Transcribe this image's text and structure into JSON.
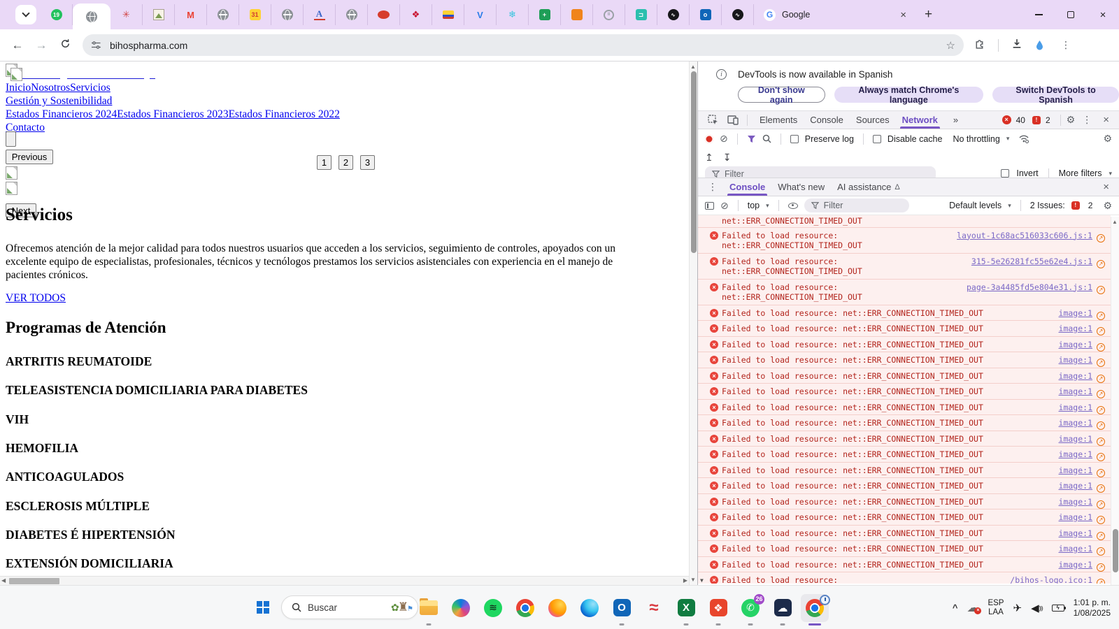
{
  "icons": {
    "back": "←",
    "forward": "→",
    "star": "☆",
    "more": "⋮",
    "overflow": "»",
    "caret": "▾",
    "clear": "⊘",
    "gear": "⚙",
    "close": "×",
    "plus": "+",
    "up_arrow": "↥",
    "down_arrow": "↧",
    "scroll_up": "▲",
    "scroll_down": "▼",
    "scroll_left": "◀",
    "scroll_right": "▶",
    "insight": "↗",
    "flask": "Δ",
    "info": "i",
    "error_x": "×",
    "issues_mark": "!",
    "flower": "✿",
    "castle": "♜",
    "bunting": "⚑",
    "airplane": "✈",
    "speaker": "◀",
    "bolt": "ϟ",
    "cloud": "☁",
    "hidden_chevron": "^"
  },
  "browser": {
    "tab_strip_color": "#ead9f7",
    "pinned_tabs": [
      {
        "name": "whatsapp-web-tab",
        "type": "circle",
        "bg": "#22c15e",
        "fg": "#ffffff",
        "glyph": "19"
      },
      {
        "name": "bihospharma-active-tab",
        "type": "globe",
        "active": true
      },
      {
        "name": "sparkle-tab",
        "type": "text",
        "glyph": "✳",
        "fg": "#d04545"
      },
      {
        "name": "photo-tab",
        "type": "photo"
      },
      {
        "name": "gmail-tab",
        "type": "text",
        "glyph": "M",
        "fg": "#ea4335"
      },
      {
        "name": "globe-tab-1",
        "type": "globe"
      },
      {
        "name": "calendar-tab",
        "type": "box",
        "bg": "#ffd234",
        "fg": "#d03c2e",
        "glyph": "31"
      },
      {
        "name": "globe-tab-2",
        "type": "globe"
      },
      {
        "name": "serif-a-tab",
        "type": "text",
        "glyph": "A",
        "fg": "#3b66c9",
        "serif": true
      },
      {
        "name": "globe-tab-3",
        "type": "globe"
      },
      {
        "name": "red-oval-tab",
        "type": "oval",
        "bg": "#d63c2e"
      },
      {
        "name": "maple-leaf-tab",
        "type": "text",
        "glyph": "❖",
        "fg": "#c8102e"
      },
      {
        "name": "colombia-flag-tab",
        "type": "flag"
      },
      {
        "name": "v-logo-tab",
        "type": "text",
        "glyph": "V",
        "fg": "#2b7de9"
      },
      {
        "name": "cyan-ornament-tab",
        "type": "text",
        "glyph": "❄",
        "fg": "#38c5de"
      },
      {
        "name": "green-cross-tab",
        "type": "box",
        "bg": "#1e9e57",
        "fg": "#ffffff",
        "glyph": "+"
      },
      {
        "name": "orange-cube-tab",
        "type": "box",
        "bg": "#f0841c",
        "fg": "#ffb566",
        "glyph": ""
      },
      {
        "name": "silver-ring-tab",
        "type": "ring",
        "glyph": "II"
      },
      {
        "name": "teal-d-tab",
        "type": "box",
        "bg": "#2bbfae",
        "fg": "#ffffff",
        "glyph": "⊐"
      },
      {
        "name": "dark-s-tab-1",
        "type": "circle",
        "bg": "#17181a",
        "fg": "#ffffff",
        "glyph": "∿"
      },
      {
        "name": "outlook-tab",
        "type": "box",
        "bg": "#1066b8",
        "fg": "#ffffff",
        "glyph": "o"
      },
      {
        "name": "dark-s-tab-2",
        "type": "circle",
        "bg": "#17181a",
        "fg": "#ffffff",
        "glyph": "∿"
      }
    ],
    "google_tab": {
      "title": "Google",
      "favicon_letter": "G"
    },
    "url": "bihospharma.com"
  },
  "page": {
    "nav_links": [
      "InicioNosotrosServicios",
      "Gestión y Sostenibilidad",
      "Estados Financieros 2024Estados Financieros 2023Estados Financieros 2022",
      "Contacto"
    ],
    "carousel": {
      "previous_label": "Previous",
      "next_label": "Next",
      "pages": [
        "1",
        "2",
        "3"
      ]
    },
    "section_title": "Servicios",
    "intro_paragraph": "Ofrecemos atención de la mejor calidad para todos nuestros usuarios que acceden a los servicios, seguimiento de controles, apoyados con un excelente equipo de especialistas, profesionales, técnicos y tecnólogos prestamos los servicios asistenciales con experiencia en el manejo de pacientes crónicos.",
    "ver_todos_link": "VER TODOS",
    "programs_title": "Programas de Atención",
    "programs": [
      "ARTRITIS REUMATOIDE",
      "TELEASISTENCIA DOMICILIARIA PARA DIABETES",
      "VIH",
      "HEMOFILIA",
      "ANTICOAGULADOS",
      "ESCLEROSIS MÚLTIPLE",
      "DIABETES É HIPERTENSIÓN",
      "EXTENSIÓN DOMICILIARIA"
    ]
  },
  "devtools": {
    "notification": {
      "text": "DevTools is now available in Spanish",
      "buttons": [
        "Don't show again",
        "Always match Chrome's language",
        "Switch DevTools to Spanish"
      ]
    },
    "tabs": [
      "Elements",
      "Console",
      "Sources",
      "Network"
    ],
    "active_tab": "Network",
    "error_count": "40",
    "issue_count": "2",
    "network": {
      "preserve_log": "Preserve log",
      "disable_cache": "Disable cache",
      "throttling": "No throttling",
      "filter_placeholder": "Filter",
      "invert": "Invert",
      "more_filters": "More filters"
    },
    "drawer_tabs": [
      "Console",
      "What's new",
      "AI assistance"
    ],
    "drawer_active": "Console",
    "console": {
      "context": "top",
      "filter_placeholder": "Filter",
      "levels": "Default levels",
      "issues_text": "2 Issues:",
      "issues_count": "2",
      "error_prefix": "Failed to load resource:",
      "error_reason": "net::ERR_CONNECTION_TIMED_OUT",
      "messages": [
        {
          "kind": "cont"
        },
        {
          "kind": "wrap",
          "source": "layout-1c68ac516033c606.js:1"
        },
        {
          "kind": "wrap",
          "source": "315-5e26281fc55e62e4.js:1"
        },
        {
          "kind": "wrap",
          "source": "page-3a4485fd5e804e31.js:1"
        },
        {
          "kind": "line",
          "source": "image:1"
        },
        {
          "kind": "line",
          "source": "image:1"
        },
        {
          "kind": "line",
          "source": "image:1"
        },
        {
          "kind": "line",
          "source": "image:1"
        },
        {
          "kind": "line",
          "source": "image:1"
        },
        {
          "kind": "line",
          "source": "image:1"
        },
        {
          "kind": "line",
          "source": "image:1"
        },
        {
          "kind": "line",
          "source": "image:1"
        },
        {
          "kind": "line",
          "source": "image:1"
        },
        {
          "kind": "line",
          "source": "image:1"
        },
        {
          "kind": "line",
          "source": "image:1"
        },
        {
          "kind": "line",
          "source": "image:1"
        },
        {
          "kind": "line",
          "source": "image:1"
        },
        {
          "kind": "line",
          "source": "image:1"
        },
        {
          "kind": "line",
          "source": "image:1"
        },
        {
          "kind": "line",
          "source": "image:1"
        },
        {
          "kind": "line",
          "source": "image:1"
        },
        {
          "kind": "wrap",
          "source": "/bihos-logo.ico:1",
          "caret": true
        }
      ]
    }
  },
  "taskbar": {
    "search_placeholder": "Buscar",
    "apps": [
      {
        "name": "file-explorer",
        "type": "folder",
        "open": true
      },
      {
        "name": "copilot",
        "type": "copilot"
      },
      {
        "name": "spotify",
        "type": "circle",
        "bg": "#1ed760",
        "fg": "#101010",
        "glyph": "≋"
      },
      {
        "name": "chrome",
        "type": "chrome"
      },
      {
        "name": "firefox",
        "type": "firefox"
      },
      {
        "name": "edge",
        "type": "edge"
      },
      {
        "name": "outlook",
        "type": "box",
        "bg": "#1066b8",
        "fg": "#ffffff",
        "glyph": "O",
        "open": true
      },
      {
        "name": "expressvpn",
        "type": "text",
        "glyph": "≈",
        "fg": "#d93a40"
      },
      {
        "name": "excel",
        "type": "box",
        "bg": "#107c41",
        "fg": "#ffffff",
        "glyph": "X",
        "open": true
      },
      {
        "name": "recoverit",
        "type": "box",
        "bg": "#e8452c",
        "fg": "#ffffff",
        "glyph": "❖",
        "open": true
      },
      {
        "name": "whatsapp",
        "type": "circle",
        "bg": "#25d366",
        "fg": "#ffffff",
        "glyph": "✆",
        "badge": "26",
        "open": true
      },
      {
        "name": "onedrive",
        "type": "box",
        "bg": "#1c2b4a",
        "fg": "#ffffff",
        "glyph": "☁",
        "open": true
      },
      {
        "name": "chrome-profile",
        "type": "chrome",
        "active": true,
        "clock": true,
        "open": true
      }
    ],
    "tray": {
      "lang_line1": "ESP",
      "lang_line2": "LAA",
      "time": "1:01 p. m.",
      "date": "1/08/2025"
    }
  }
}
